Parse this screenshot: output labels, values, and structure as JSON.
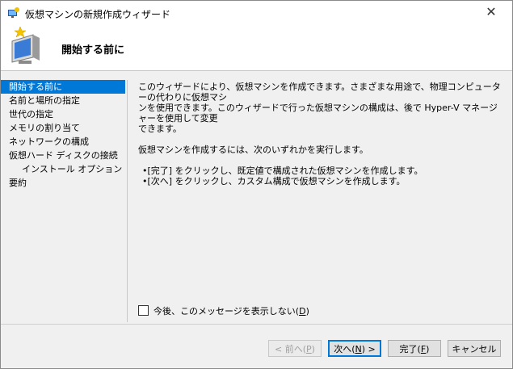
{
  "window": {
    "title": "仮想マシンの新規作成ウィザード",
    "close_glyph": "✕"
  },
  "banner": {
    "heading": "開始する前に"
  },
  "nav": {
    "items": [
      {
        "label": "開始する前に",
        "active": true,
        "indent": false
      },
      {
        "label": "名前と場所の指定",
        "active": false,
        "indent": false
      },
      {
        "label": "世代の指定",
        "active": false,
        "indent": false
      },
      {
        "label": "メモリの割り当て",
        "active": false,
        "indent": false
      },
      {
        "label": "ネットワークの構成",
        "active": false,
        "indent": false
      },
      {
        "label": "仮想ハード ディスクの接続",
        "active": false,
        "indent": false
      },
      {
        "label": "インストール オプション",
        "active": false,
        "indent": true
      },
      {
        "label": "要約",
        "active": false,
        "indent": false
      }
    ]
  },
  "content": {
    "para1_line1": "このウィザードにより、仮想マシンを作成できます。さまざまな用途で、物理コンピューターの代わりに仮想マシ",
    "para1_line2": "ンを使用できます。このウィザードで行った仮想マシンの構成は、後で Hyper-V マネージャーを使用して変更",
    "para1_line3": "できます。",
    "para2": "仮想マシンを作成するには、次のいずれかを実行します。",
    "bullet1": "•[完了] をクリックし、既定値で構成された仮想マシンを作成します。",
    "bullet2": "•[次へ] をクリックし、カスタム構成で仮想マシンを作成します。"
  },
  "checkbox": {
    "label_text": "今後、このメッセージを表示しない(",
    "label_key": "D",
    "label_end": ")",
    "checked": false
  },
  "buttons": {
    "prev": {
      "text": "< 前へ(",
      "key": "P",
      "end": ")",
      "enabled": false
    },
    "next": {
      "text": "次へ(",
      "key": "N",
      "end": ") >",
      "enabled": true
    },
    "finish": {
      "text": "完了(",
      "key": "F",
      "end": ")",
      "enabled": true
    },
    "cancel": {
      "text": "キャンセル",
      "enabled": true
    }
  },
  "colors": {
    "accent": "#0078d7"
  }
}
